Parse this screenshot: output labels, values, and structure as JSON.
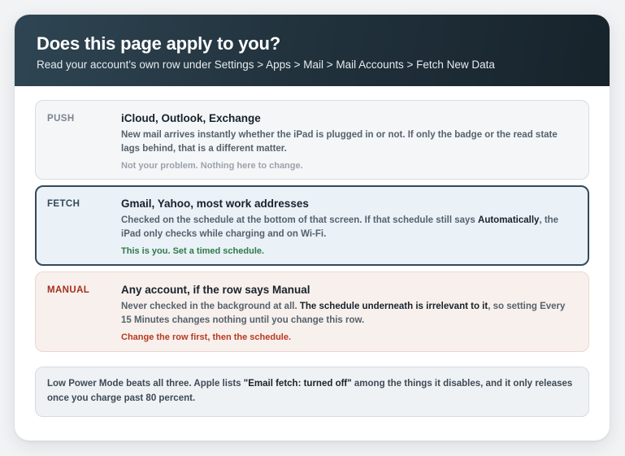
{
  "header": {
    "title": "Does this page apply to you?",
    "subtitle": "Read your account's own row under Settings > Apps > Mail > Mail Accounts > Fetch New Data"
  },
  "rows": [
    {
      "tag": "PUSH",
      "title": "iCloud, Outlook, Exchange",
      "desc_parts": [
        "New mail arrives instantly whether the iPad is plugged in or not. If only the badge or the read state lags behind, that is a different matter."
      ],
      "verdict": "Not your problem. Nothing here to change."
    },
    {
      "tag": "FETCH",
      "title": "Gmail, Yahoo, most work addresses",
      "desc_before": "Checked on the schedule at the bottom of that screen. If that schedule still says ",
      "desc_bold": "Automatically",
      "desc_after": ", the iPad only checks while charging and on Wi-Fi.",
      "verdict": "This is you. Set a timed schedule."
    },
    {
      "tag": "MANUAL",
      "title": "Any account, if the row says Manual",
      "desc_before": "Never checked in the background at all. ",
      "desc_bold": "The schedule underneath is irrelevant to it",
      "desc_after": ", so setting Every 15 Minutes changes nothing until you change this row.",
      "verdict": "Change the row first, then the schedule."
    }
  ],
  "note": {
    "before": "Low Power Mode beats all three. Apple lists ",
    "bold": "\"Email fetch: turned off\"",
    "after": " among the things it disables, and it only releases once you charge past 80 percent."
  },
  "colors": {
    "header_dark": "#17232b",
    "fetch_border": "#34495a",
    "manual_accent": "#a3301e",
    "fetch_verdict": "#2f7a4a"
  }
}
